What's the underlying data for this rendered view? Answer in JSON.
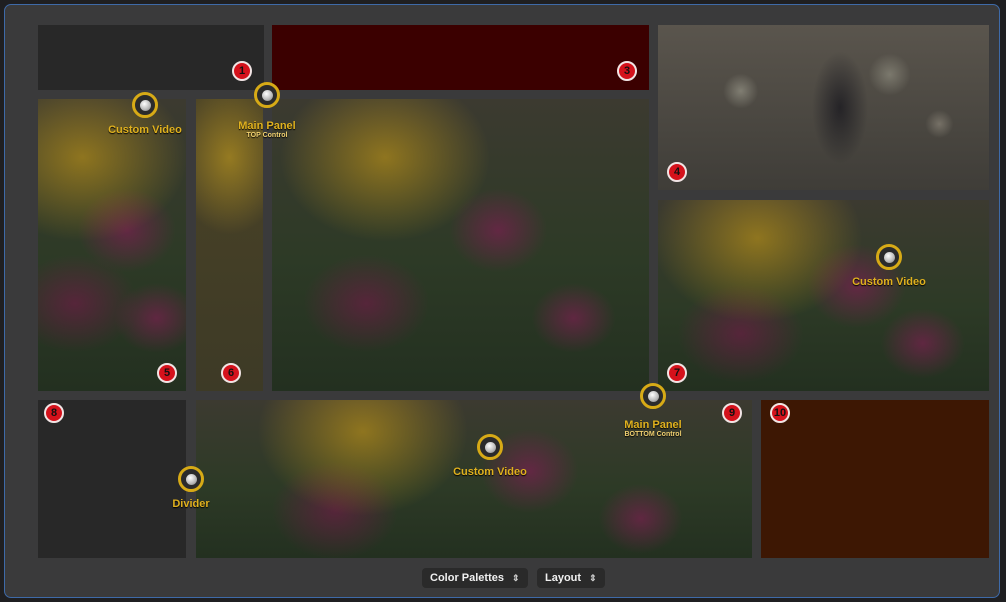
{
  "badges": [
    "1",
    "3",
    "4",
    "5",
    "6",
    "7",
    "8",
    "9",
    "10"
  ],
  "knob_labels": {
    "custom_video": "Custom Video",
    "main_panel": "Main Panel",
    "top_control": "TOP Control",
    "bottom_control": "BOTTOM Control",
    "divider": "Divider"
  },
  "toolbar": {
    "color_palettes": "Color Palettes",
    "layout": "Layout"
  },
  "icons": {
    "dropdown": "up-down-chevron-icon",
    "handle": "knob-icon"
  },
  "colors": {
    "accent": "#d7aa16",
    "badge": "#d4111b",
    "frame_border": "#3e6aa8"
  }
}
